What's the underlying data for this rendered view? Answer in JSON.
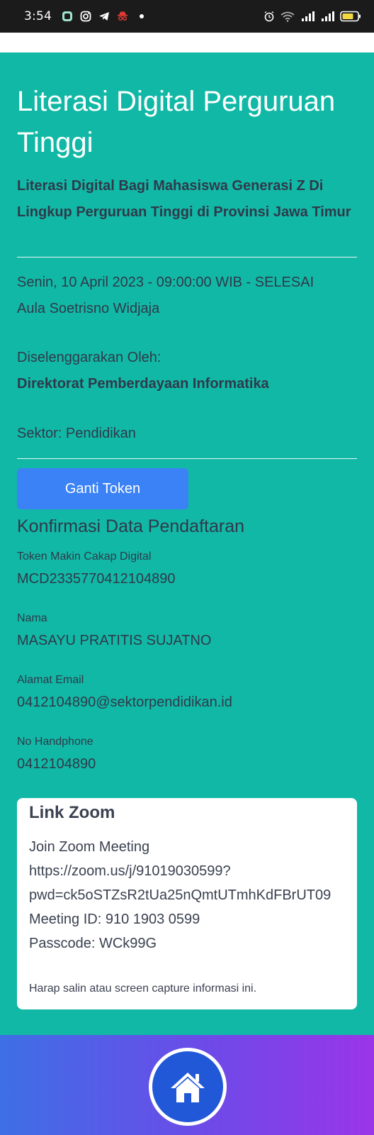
{
  "status_bar": {
    "time": "3:54",
    "icons": [
      "chat-app-icon",
      "instagram-icon",
      "telegram-icon",
      "incognito-icon",
      "notification-dot",
      "alarm-icon",
      "wifi-icon",
      "signal-icon",
      "signal-icon",
      "battery-icon"
    ]
  },
  "header": {
    "title": "Literasi Digital Perguruan Tinggi",
    "subtitle": "Literasi Digital Bagi Mahasiswa Generasi Z Di Lingkup Perguruan Tinggi di Provinsi Jawa Timur"
  },
  "event": {
    "datetime": "Senin, 10 April 2023 - 09:00:00 WIB - SELESAI",
    "venue": "Aula Soetrisno Widjaja",
    "organizer_label": "Diselenggarakan Oleh:",
    "organizer": "Direktorat Pemberdayaan Informatika",
    "sector": "Sektor: Pendidikan"
  },
  "buttons": {
    "change_token": "Ganti Token"
  },
  "registration": {
    "section_title": "Konfirmasi Data Pendaftaran",
    "fields": [
      {
        "label": "Token Makin Cakap Digital",
        "value": "MCD2335770412104890"
      },
      {
        "label": "Nama",
        "value": "MASAYU PRATITIS SUJATNO"
      },
      {
        "label": "Alamat Email",
        "value": "0412104890@sektorpendidikan.id"
      },
      {
        "label": "No Handphone",
        "value": "0412104890"
      }
    ]
  },
  "zoom": {
    "title": "Link Zoom",
    "lines": [
      "Join Zoom Meeting",
      "https://zoom.us/j/91019030599?",
      "pwd=ck5oSTZsR2tUa25nQmtUTmhKdFBrUT09",
      "Meeting ID: 910 1903 0599",
      "Passcode: WCk99G"
    ],
    "note": "Harap salin atau screen capture informasi ini."
  },
  "colors": {
    "main_bg": "#12b8a6",
    "button": "#3b82f6",
    "home_button": "#2158d8",
    "nav_gradient_start": "#3e6fe6",
    "nav_gradient_end": "#9a35e8"
  }
}
